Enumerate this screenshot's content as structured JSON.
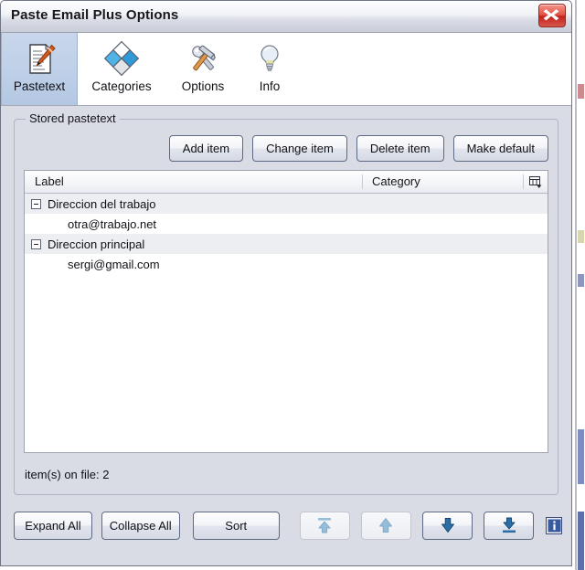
{
  "window": {
    "title": "Paste Email Plus Options",
    "close_icon": "close-icon"
  },
  "tabs": [
    {
      "label": "Pastetext",
      "icon": "document-pen-icon",
      "selected": true
    },
    {
      "label": "Categories",
      "icon": "color-diamond-icon",
      "selected": false
    },
    {
      "label": "Options",
      "icon": "wrench-hammer-icon",
      "selected": false
    },
    {
      "label": "Info",
      "icon": "lightbulb-icon",
      "selected": false
    }
  ],
  "groupbox": {
    "legend": "Stored pastetext"
  },
  "actions": [
    {
      "label": "Add item"
    },
    {
      "label": "Change item"
    },
    {
      "label": "Delete item"
    },
    {
      "label": "Make default"
    }
  ],
  "list": {
    "columns": [
      "Label",
      "Category"
    ],
    "column_chooser_icon": "column-chooser-icon",
    "rows": [
      {
        "type": "group",
        "label": "Direccion del trabajo",
        "category": "",
        "expander": "minus"
      },
      {
        "type": "child",
        "label": "otra@trabajo.net",
        "category": ""
      },
      {
        "type": "group",
        "label": "Direccion principal",
        "category": "",
        "expander": "minus"
      },
      {
        "type": "child",
        "label": "sergi@gmail.com",
        "category": ""
      }
    ]
  },
  "status": {
    "text": "item(s) on file: 2"
  },
  "bottom": {
    "buttons": [
      {
        "label": "Expand All",
        "kind": "text",
        "enabled": true
      },
      {
        "label": "Collapse All",
        "kind": "text",
        "enabled": true
      },
      {
        "label": "Sort",
        "kind": "text",
        "enabled": true
      }
    ],
    "arrow_buttons": [
      {
        "icon": "arrow-up-to-top-icon",
        "enabled": false
      },
      {
        "icon": "arrow-up-icon",
        "enabled": false
      },
      {
        "icon": "arrow-down-icon",
        "enabled": true
      },
      {
        "icon": "arrow-down-to-bottom-icon",
        "enabled": true
      }
    ],
    "info_icon": "info-icon"
  },
  "colors": {
    "accent": "#3a6ea5",
    "window_bg": "#d9dce4",
    "selected_tab": "#bed0e8",
    "close_red": "#c3231c",
    "arrow_enabled": "#1d4f86",
    "arrow_disabled": "#96bed8"
  }
}
